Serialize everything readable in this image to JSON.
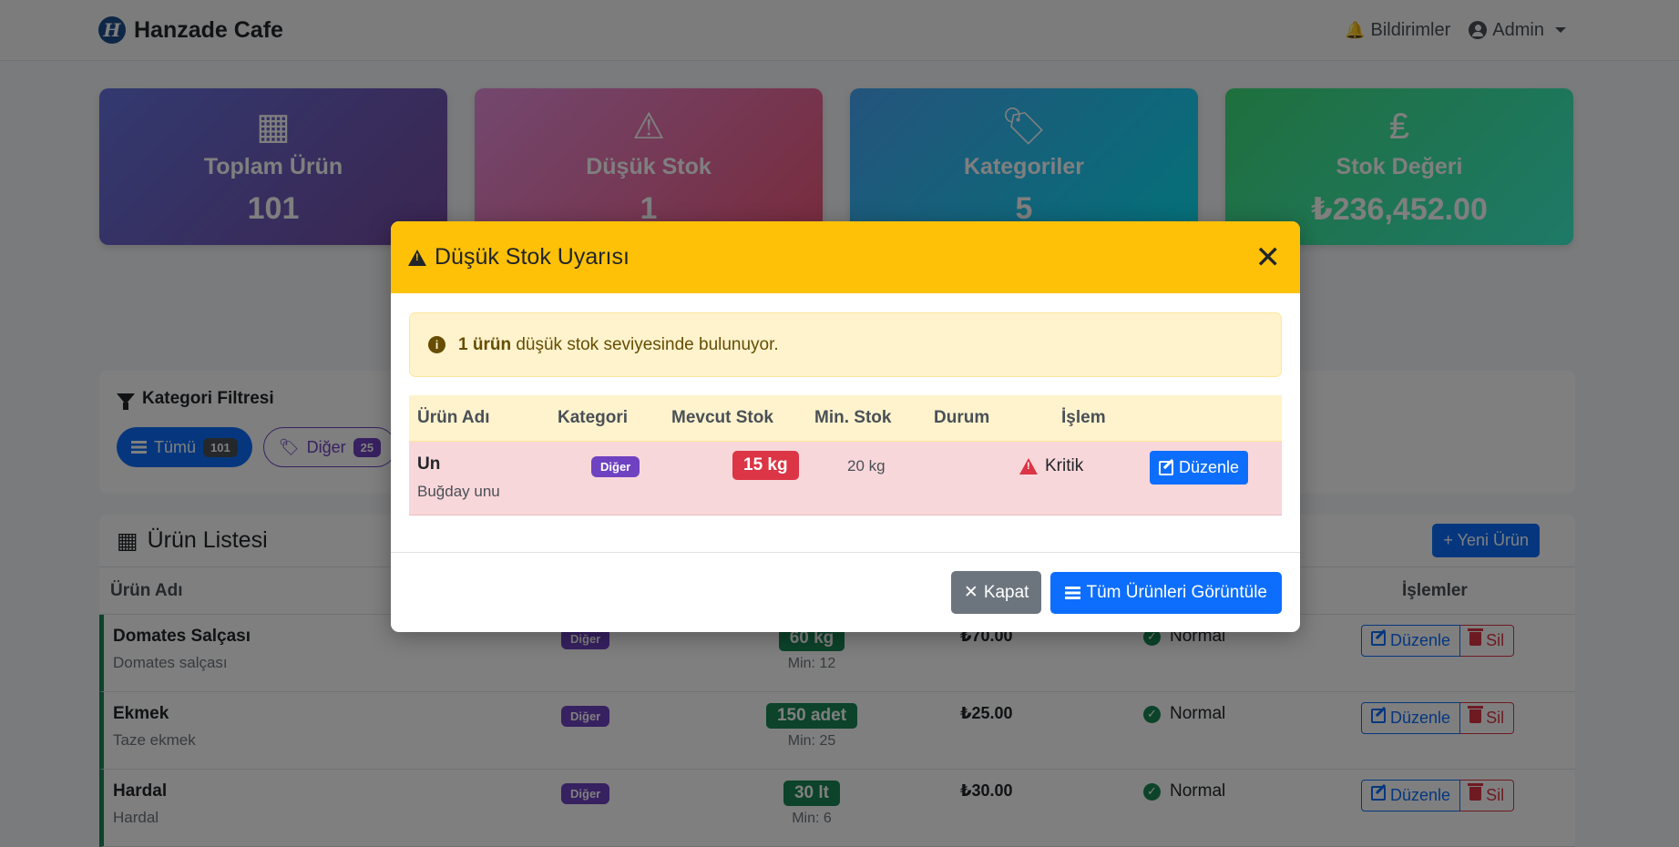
{
  "navbar": {
    "brand_logo": "H",
    "brand": "Hanzade Cafe",
    "notifications": "Bildirimler",
    "user": "Admin"
  },
  "stats": [
    {
      "icon": "boxes-icon",
      "glyph": "▦",
      "title": "Toplam Ürün",
      "value": "101"
    },
    {
      "icon": "warning-icon",
      "glyph": "⚠",
      "title": "Düşük Stok",
      "value": "1"
    },
    {
      "icon": "tags-icon",
      "glyph": "🏷",
      "title": "Kategoriler",
      "value": "5"
    },
    {
      "icon": "lira-icon",
      "glyph": "₤",
      "title": "Stok Değeri",
      "value": "₺236,452.00"
    }
  ],
  "filter": {
    "title": "Kategori Filtresi",
    "pills": [
      {
        "label": "Tümü",
        "count": "101"
      },
      {
        "label": "Diğer",
        "count": "25"
      }
    ]
  },
  "product_list": {
    "title": "Ürün Listesi",
    "new_button": "Yeni Ürün",
    "col_name": "Ürün Adı",
    "col_actions": "İşlemler",
    "rows": [
      {
        "name": "Domates Salçası",
        "desc": "Domates salçası",
        "category": "Diğer",
        "stock": "60 kg",
        "min": "Min: 12",
        "price": "₺70.00",
        "status": "Normal"
      },
      {
        "name": "Ekmek",
        "desc": "Taze ekmek",
        "category": "Diğer",
        "stock": "150 adet",
        "min": "Min: 25",
        "price": "₺25.00",
        "status": "Normal"
      },
      {
        "name": "Hardal",
        "desc": "Hardal",
        "category": "Diğer",
        "stock": "30 lt",
        "min": "Min: 6",
        "price": "₺30.00",
        "status": "Normal"
      }
    ],
    "edit_label": "Düzenle",
    "delete_label": "Sil"
  },
  "modal": {
    "title": "Düşük Stok Uyarısı",
    "alert_bold": "1 ürün",
    "alert_text": " düşük stok seviyesinde bulunuyor.",
    "headers": {
      "name": "Ürün Adı",
      "category": "Kategori",
      "stock": "Mevcut Stok",
      "min": "Min. Stok",
      "status": "Durum",
      "action": "İşlem"
    },
    "row": {
      "name": "Un",
      "desc": "Buğday unu",
      "category": "Diğer",
      "stock": "15 kg",
      "min": "20 kg",
      "status": "Kritik",
      "edit": "Düzenle"
    },
    "close_button": "Kapat",
    "view_all_button": "Tüm Ürünleri Görüntüle"
  },
  "colors": {
    "primary": "#0d6efd",
    "warning": "#ffc107",
    "danger": "#dc3545",
    "success": "#198754",
    "purple": "#6f42c1"
  }
}
